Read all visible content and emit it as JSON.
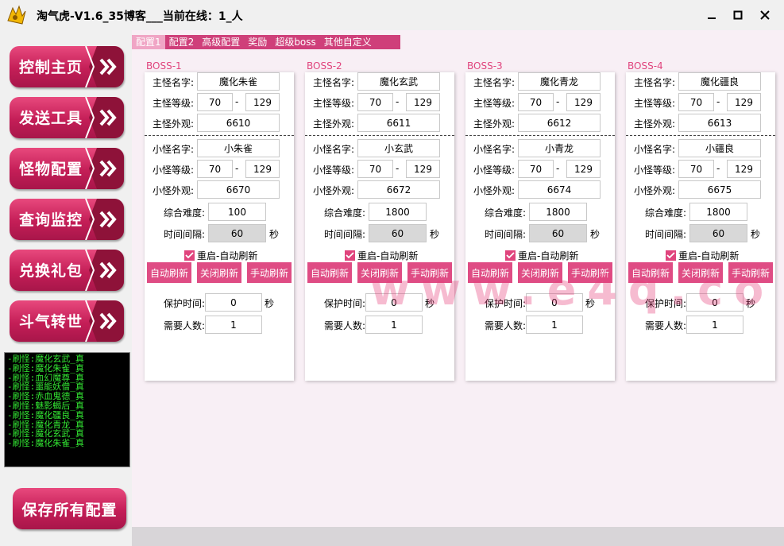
{
  "window": {
    "title": "淘气虎-V1.6_35博客___当前在线：1_人"
  },
  "sidebar": {
    "nav": [
      {
        "label": "控制主页"
      },
      {
        "label": "发送工具"
      },
      {
        "label": "怪物配置"
      },
      {
        "label": "查询监控"
      },
      {
        "label": "兑换礼包"
      },
      {
        "label": "斗气转世"
      }
    ],
    "log_lines": [
      "-刷怪:魔化玄武_真",
      "-刷怪:魔化朱雀_真",
      "-刷怪:血幻魔尊_真",
      "-刷怪:噩能妖僧_真",
      "-刷怪:赤血鬼德_真",
      "-刷怪:魅影蝎后_真",
      "-刷怪:魔化疆良_真",
      "-刷怪:魔化青龙_真",
      "-刷怪:魔化玄武_真",
      "-刷怪:魔化朱雀_真"
    ],
    "save_label": "保存所有配置"
  },
  "tabs": [
    "配置1",
    "配置2",
    "高级配置",
    "奖励",
    "超级boss",
    "其他自定义"
  ],
  "labels": {
    "main_name": "主怪名字:",
    "main_level": "主怪等级:",
    "main_look": "主怪外观:",
    "sub_name": "小怪名字:",
    "sub_level": "小怪等级:",
    "sub_look": "小怪外观:",
    "difficulty": "综合难度:",
    "interval": "时间间隔:",
    "seconds": "秒",
    "dash": "-",
    "restart_auto": "重启-自动刷新",
    "auto_refresh": "自动刷新",
    "close_refresh": "关闭刷新",
    "manual_refresh": "手动刷新",
    "protect_time": "保护时间:",
    "need_people": "需要人数:"
  },
  "bosses": [
    {
      "title": "BOSS-1",
      "main_name": "魔化朱雀",
      "main_min": "70",
      "main_max": "129",
      "main_look": "6610",
      "sub_name": "小朱雀",
      "sub_min": "70",
      "sub_max": "129",
      "sub_look": "6670",
      "difficulty": "100",
      "interval": "60",
      "restart_checked": true,
      "protect": "0",
      "people": "1"
    },
    {
      "title": "BOSS-2",
      "main_name": "魔化玄武",
      "main_min": "70",
      "main_max": "129",
      "main_look": "6611",
      "sub_name": "小玄武",
      "sub_min": "70",
      "sub_max": "129",
      "sub_look": "6672",
      "difficulty": "1800",
      "interval": "60",
      "restart_checked": true,
      "protect": "0",
      "people": "1"
    },
    {
      "title": "BOSS-3",
      "main_name": "魔化青龙",
      "main_min": "70",
      "main_max": "129",
      "main_look": "6612",
      "sub_name": "小青龙",
      "sub_min": "70",
      "sub_max": "129",
      "sub_look": "6674",
      "difficulty": "1800",
      "interval": "60",
      "restart_checked": true,
      "protect": "0",
      "people": "1"
    },
    {
      "title": "BOSS-4",
      "main_name": "魔化疆良",
      "main_min": "70",
      "main_max": "129",
      "main_look": "6613",
      "sub_name": "小疆良",
      "sub_min": "70",
      "sub_max": "129",
      "sub_look": "6675",
      "difficulty": "1800",
      "interval": "60",
      "restart_checked": true,
      "protect": "0",
      "people": "1"
    }
  ],
  "watermark": "www.e4q.co",
  "colors": {
    "accent": "#e0447d",
    "nav_button": "#c41e57",
    "log_text": "#33e833"
  }
}
